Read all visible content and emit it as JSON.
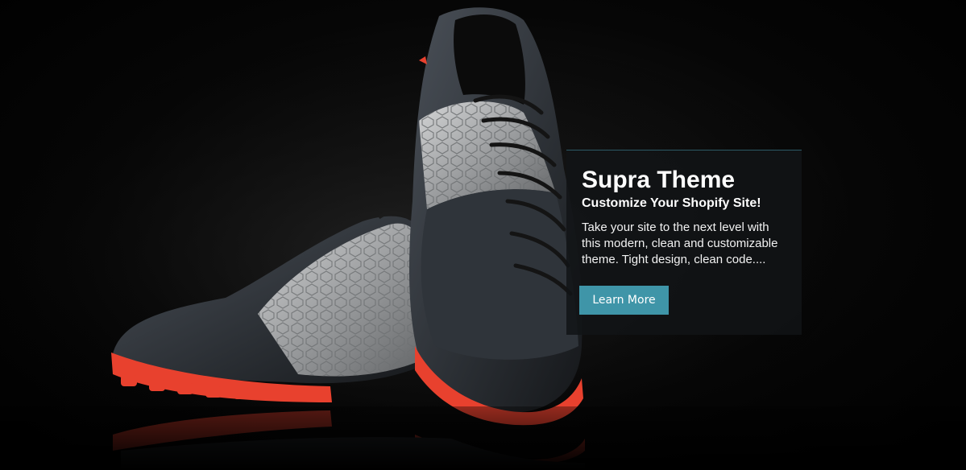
{
  "slide": {
    "image": "soccer-cleats-photo",
    "caption": {
      "title": "Supra Theme",
      "subtitle": "Customize Your Shopify Site!",
      "body": "Take your site to the next level with this modern, clean and customizable theme. Tight design, clean code....",
      "button_label": "Learn More"
    }
  },
  "colors": {
    "button": "#3f95a8",
    "panel": "#121416",
    "sole": "#e8412e",
    "upper_dark": "#2a2e33",
    "upper_silver": "#a7a9ab"
  }
}
